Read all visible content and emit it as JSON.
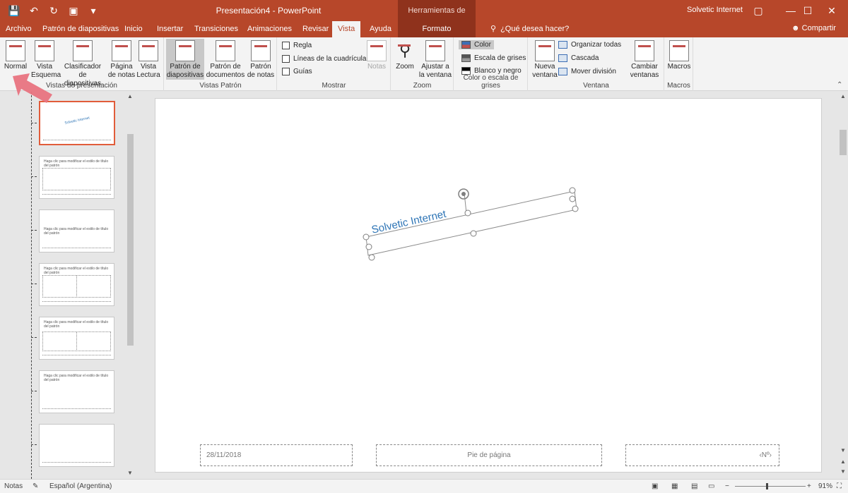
{
  "titlebar": {
    "doc_title": "Presentación4 - PowerPoint",
    "context_header": "Herramientas de dibujo",
    "user": "Solvetic Internet",
    "qat": [
      "save-icon",
      "undo-icon",
      "redo-icon",
      "present-icon",
      "customize-icon"
    ],
    "window_buttons": [
      "ribbon-display-icon",
      "minimize-icon",
      "maximize-icon",
      "close-icon"
    ]
  },
  "tabs": [
    "Archivo",
    "Patrón de diapositivas",
    "Inicio",
    "Insertar",
    "Transiciones",
    "Animaciones",
    "Revisar",
    "Vista",
    "Ayuda",
    "Formato"
  ],
  "active_tab": "Vista",
  "tell_me": "¿Qué desea hacer?",
  "share": "Compartir",
  "ribbon": {
    "vistas_presentacion": {
      "label": "Vistas de presentación",
      "buttons": [
        "Normal",
        "Vista Esquema",
        "Clasificador de diapositivas",
        "Página de notas",
        "Vista Lectura"
      ]
    },
    "vistas_patron": {
      "label": "Vistas Patrón",
      "buttons": [
        "Patrón de diapositivas",
        "Patrón de documentos",
        "Patrón de notas"
      ]
    },
    "mostrar": {
      "label": "Mostrar",
      "checks": [
        "Regla",
        "Líneas de la cuadrícula",
        "Guías"
      ],
      "notas": "Notas"
    },
    "zoom": {
      "label": "Zoom",
      "buttons": [
        "Zoom",
        "Ajustar a la ventana"
      ]
    },
    "color": {
      "label": "Color o escala de grises",
      "options": [
        "Color",
        "Escala de grises",
        "Blanco y negro"
      ]
    },
    "ventana": {
      "label": "Ventana",
      "nueva": "Nueva ventana",
      "options": [
        "Organizar todas",
        "Cascada",
        "Mover división"
      ],
      "cambiar": "Cambiar ventanas"
    },
    "macros": {
      "label": "Macros",
      "button": "Macros"
    }
  },
  "thumbnails": [
    {
      "text": "Solvetic Internet",
      "selected": true
    },
    {
      "text": "Haga clic para modificar el estilo de título del patrón",
      "selected": false
    },
    {
      "text": "Haga clic para modificar el estilo de título del patrón",
      "selected": false
    },
    {
      "text": "Haga clic para modificar el estilo de título del patrón",
      "selected": false
    },
    {
      "text": "Haga clic para modificar el estilo de título del patrón",
      "selected": false
    },
    {
      "text": "Haga clic para modificar el estilo de título del patrón",
      "selected": false
    },
    {
      "text": "",
      "selected": false
    }
  ],
  "slide": {
    "textbox": "Solvetic Internet",
    "date": "28/11/2018",
    "footer": "Pie de página",
    "number": "‹Nº›"
  },
  "statusbar": {
    "notas": "Notas",
    "language": "Español (Argentina)",
    "zoom": "91%"
  },
  "colors": {
    "brand": "#b7472a",
    "context": "#8f321c",
    "accent_text": "#2e75b6",
    "selection": "#e15c3a"
  }
}
